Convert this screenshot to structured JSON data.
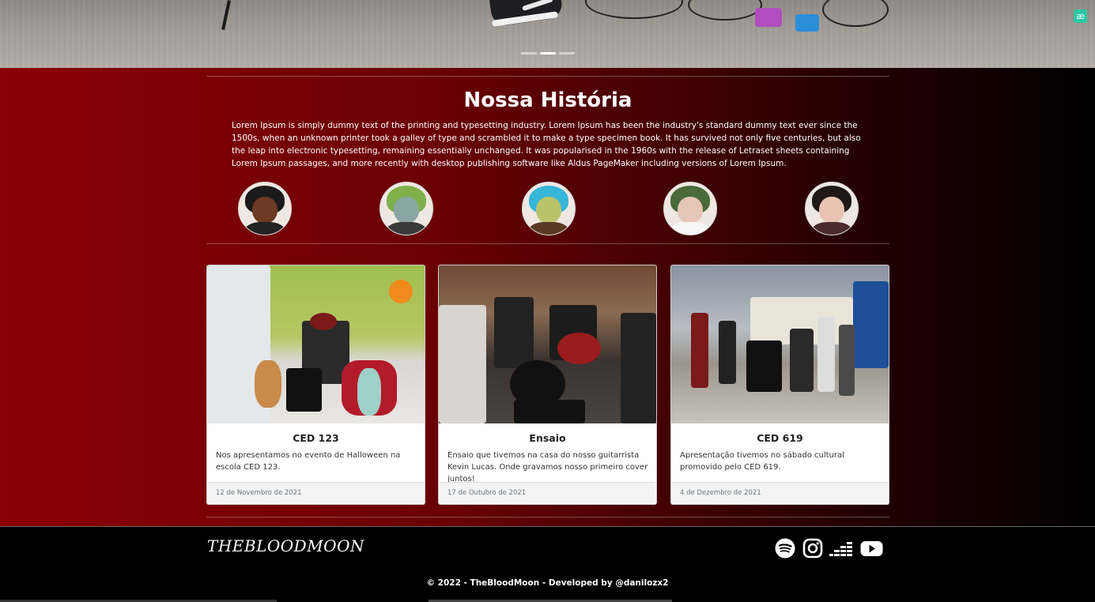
{
  "history": {
    "title": "Nossa História",
    "text": "Lorem Ipsum is simply dummy text of the printing and typesetting industry. Lorem Ipsum has been the industry's standard dummy text ever since the 1500s, when an unknown printer took a galley of type and scrambled it to make a type specimen book. It has survived not only five centuries, but also the leap into electronic typesetting, remaining essentially unchanged. It was popularised in the 1960s with the release of Letraset sheets containing Lorem Ipsum passages, and more recently with desktop publishing software like Aldus PageMaker including versions of Lorem Ipsum."
  },
  "carousel": {
    "slide_count": 3,
    "active_slide": 2
  },
  "extension_badge": "æ",
  "cards": [
    {
      "title": "CED 123",
      "text": "Nos apresentamos no evento de Halloween na escola CED 123.",
      "date": "12 de Novembro de 2021"
    },
    {
      "title": "Ensaio",
      "text": "Ensaio que tivemos na casa do nosso guitarrista Kevin Lucas. Onde gravamos nosso primeiro cover juntos!",
      "date": "17 de Outubro de 2021"
    },
    {
      "title": "CED 619",
      "text": "Apresentação tivemos no sábado cultural promovido pelo CED 619.",
      "date": "4 de Dezembro de 2021"
    }
  ],
  "footer": {
    "brand": "THEBLOODMOON",
    "social_icons": [
      "spotify-icon",
      "instagram-icon",
      "deezer-icon",
      "youtube-icon"
    ],
    "copyright": "© 2022 - TheBloodMoon - Developed by @danilozx2"
  },
  "colors": {
    "gradient_start": "#8a0004",
    "gradient_end": "#000000",
    "badge": "#2cc7a5"
  }
}
